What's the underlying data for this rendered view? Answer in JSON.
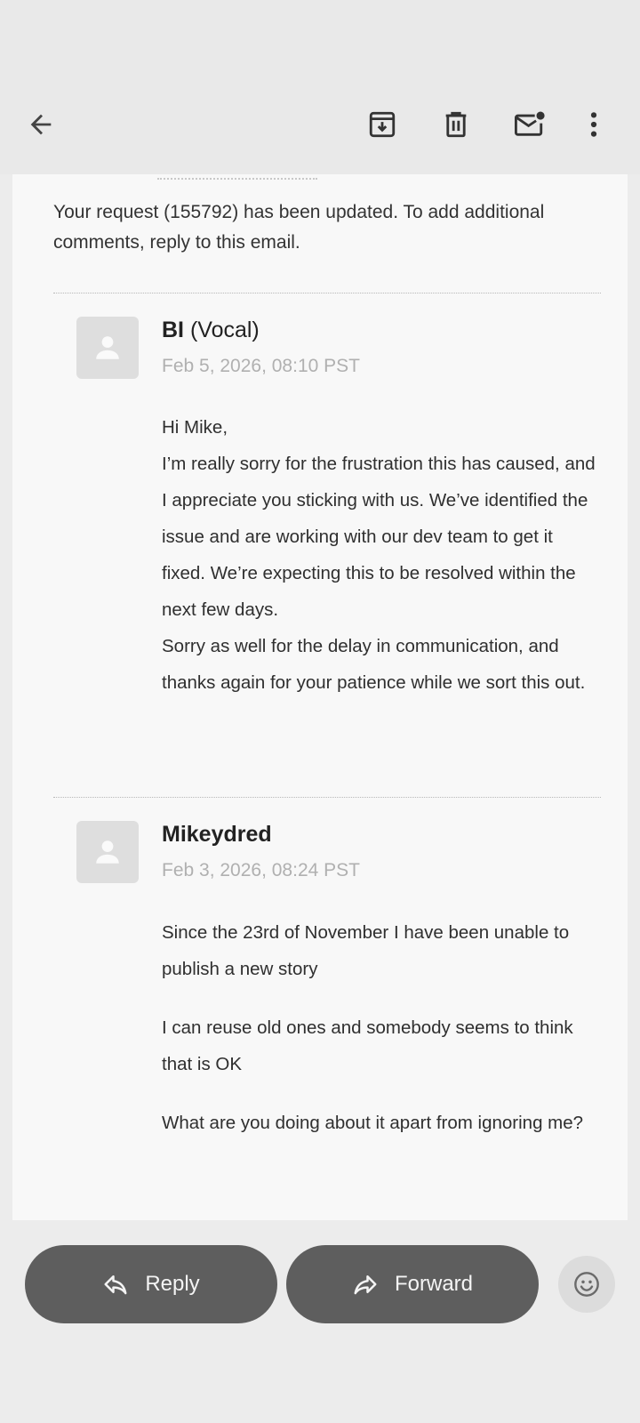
{
  "toolbar": {
    "back_icon": "back-arrow-icon",
    "archive_icon": "archive-icon",
    "delete_icon": "trash-icon",
    "mark_unread_icon": "mark-unread-icon",
    "more_icon": "more-vert-icon"
  },
  "email": {
    "intro": "Your request (155792) has been updated. To add additional comments, reply to this email.",
    "messages": [
      {
        "sender_name": "BI",
        "sender_suffix": " (Vocal)",
        "date": "Feb 5, 2026, 08:10 PST",
        "body": [
          "Hi Mike,",
          "I’m really sorry for the frustration this has caused, and I appreciate you sticking with us. We’ve identified the issue and are working with our dev team to get it fixed. We’re expecting this to be resolved within the next few days.",
          "Sorry as well for the delay in communication, and thanks again for your patience while we sort this out."
        ]
      },
      {
        "sender_name": "Mikeydred",
        "sender_suffix": "",
        "date": "Feb 3, 2026, 08:24 PST",
        "body": [
          "Since the 23rd of November I have been unable to publish a new story",
          "I can reuse old ones and somebody seems to think that is OK",
          "What are you doing about it apart from ignoring me?"
        ]
      }
    ]
  },
  "actions": {
    "reply_label": "Reply",
    "forward_label": "Forward",
    "emoji_icon": "emoji-reaction-icon"
  },
  "colors": {
    "button_bg": "#5e5e5e",
    "card_bg": "#f8f8f8",
    "page_bg": "#ececec",
    "date_text": "#b0b0b0"
  }
}
